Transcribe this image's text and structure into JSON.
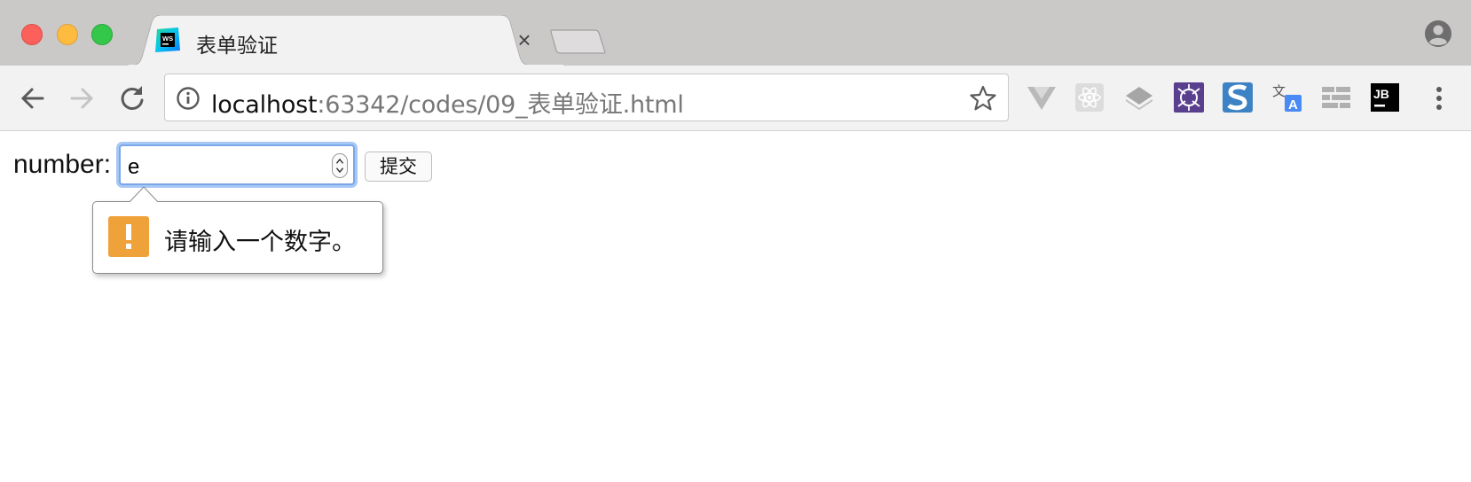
{
  "window": {
    "controls": [
      "close",
      "minimize",
      "zoom"
    ]
  },
  "tab": {
    "title": "表单验证",
    "favicon": "webstorm-icon",
    "close_label": "×"
  },
  "toolbar": {
    "url_host": "localhost",
    "url_path": ":63342/codes/09_表单验证.html",
    "extensions": [
      "vue-devtools-icon",
      "react-devtools-icon",
      "layers-icon",
      "purple-app-icon",
      "s-icon",
      "translate-icon",
      "grid-icon",
      "jetbrains-icon"
    ]
  },
  "form": {
    "label": "number:",
    "input_value": "e",
    "submit_label": "提交"
  },
  "validation": {
    "message": "请输入一个数字。",
    "icon_glyph": "!"
  },
  "colors": {
    "focus_ring": "#7aa7e8",
    "warning": "#f0a23a"
  }
}
